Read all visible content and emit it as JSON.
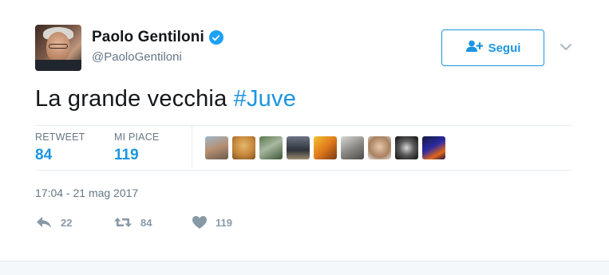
{
  "author": {
    "name": "Paolo Gentiloni",
    "handle": "@PaoloGentiloni",
    "verified": true
  },
  "follow_button": {
    "label": "Segui",
    "icon": "add-user-icon"
  },
  "tweet": {
    "text": "La grande vecchia ",
    "hashtag": "#Juve"
  },
  "stats": {
    "retweets": {
      "label": "RETWEET",
      "value": "84"
    },
    "likes": {
      "label": "MI PIACE",
      "value": "119"
    }
  },
  "likers_count_shown": 9,
  "timestamp": "17:04 - 21 mag 2017",
  "actions": {
    "reply": {
      "icon": "reply-icon",
      "count": "22"
    },
    "retweet": {
      "icon": "retweet-icon",
      "count": "84"
    },
    "like": {
      "icon": "heart-icon",
      "count": "119"
    }
  },
  "colors": {
    "accent": "#1b95e0",
    "verified": "#1da1f2",
    "muted": "#657786",
    "action_gray": "#8899a6"
  }
}
